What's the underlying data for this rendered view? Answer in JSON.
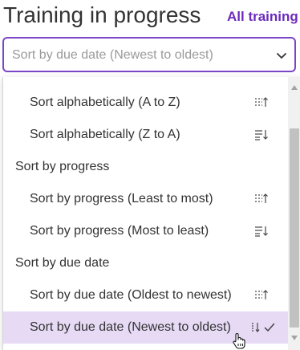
{
  "header": {
    "title": "Training in progress",
    "all_training_link": "All training"
  },
  "sort_select": {
    "value": "Sort by due date (Newest to oldest)",
    "chevron_icon": "chevron-down-icon"
  },
  "dropdown": {
    "items": [
      {
        "label": "Sort alphabetically (A to Z)",
        "icon": "sort-ascending-icon"
      },
      {
        "label": "Sort alphabetically (Z to A)",
        "icon": "sort-descending-icon"
      },
      {
        "heading": "Sort by progress"
      },
      {
        "label": "Sort by progress (Least to most)",
        "icon": "sort-ascending-icon"
      },
      {
        "label": "Sort by progress (Most to least)",
        "icon": "sort-descending-icon"
      },
      {
        "heading": "Sort by due date"
      },
      {
        "label": "Sort by due date (Oldest to newest)",
        "icon": "sort-ascending-icon"
      },
      {
        "label": "Sort by due date (Newest to oldest)",
        "icon": "sort-descending-icon",
        "selected": true
      }
    ]
  },
  "colors": {
    "accent": "#7b45c7",
    "link": "#6b2bbd",
    "selected_bg": "#e6daf5",
    "text": "#333333",
    "placeholder": "#9a9a9a"
  }
}
